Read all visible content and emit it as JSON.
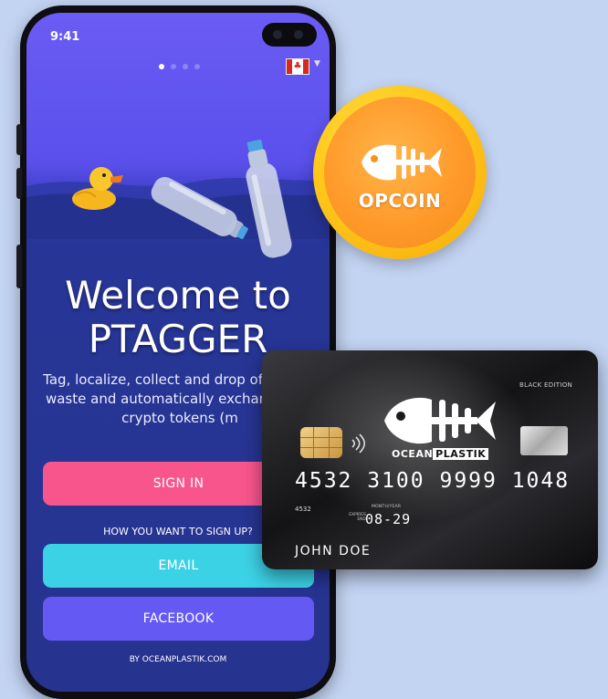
{
  "status_bar": {
    "time": "9:41"
  },
  "onboarding": {
    "page_count": 4,
    "active_page": 1,
    "welcome_line1": "Welcome to",
    "welcome_line2": "PTAGGER",
    "tagline": "Tag, localize, collect and drop off plastic waste and automatically exchangeable crypto tokens (m",
    "sign_in_label": "SIGN IN",
    "sign_up_prompt": "HOW YOU WANT TO SIGN UP?",
    "email_label": "EMAIL",
    "facebook_label": "FACEBOOK",
    "footer": "BY OCEANPLASTIK.COM",
    "language_flag": "canada-flag-icon"
  },
  "coin": {
    "label": "OPCOIN",
    "icon": "fish-skeleton-icon"
  },
  "card": {
    "edition": "BLACK EDITION",
    "brand_part1": "OCEAN",
    "brand_part2": "PLASTIK",
    "number": "4532  3100  9999  1048",
    "short_number": "4532",
    "month_year_caption": "MONTH/YEAR",
    "expires_caption": "EXPIRES END",
    "expiry": "08-29",
    "holder": "JOHN DOE"
  },
  "colors": {
    "sign_in": "#f9558d",
    "email": "#3cd2e6",
    "facebook": "#6459f2",
    "screen_top": "#6a5cf4",
    "screen_bottom": "#26348f",
    "coin": "#ffb54a",
    "page_background": "#c3d4f3"
  }
}
